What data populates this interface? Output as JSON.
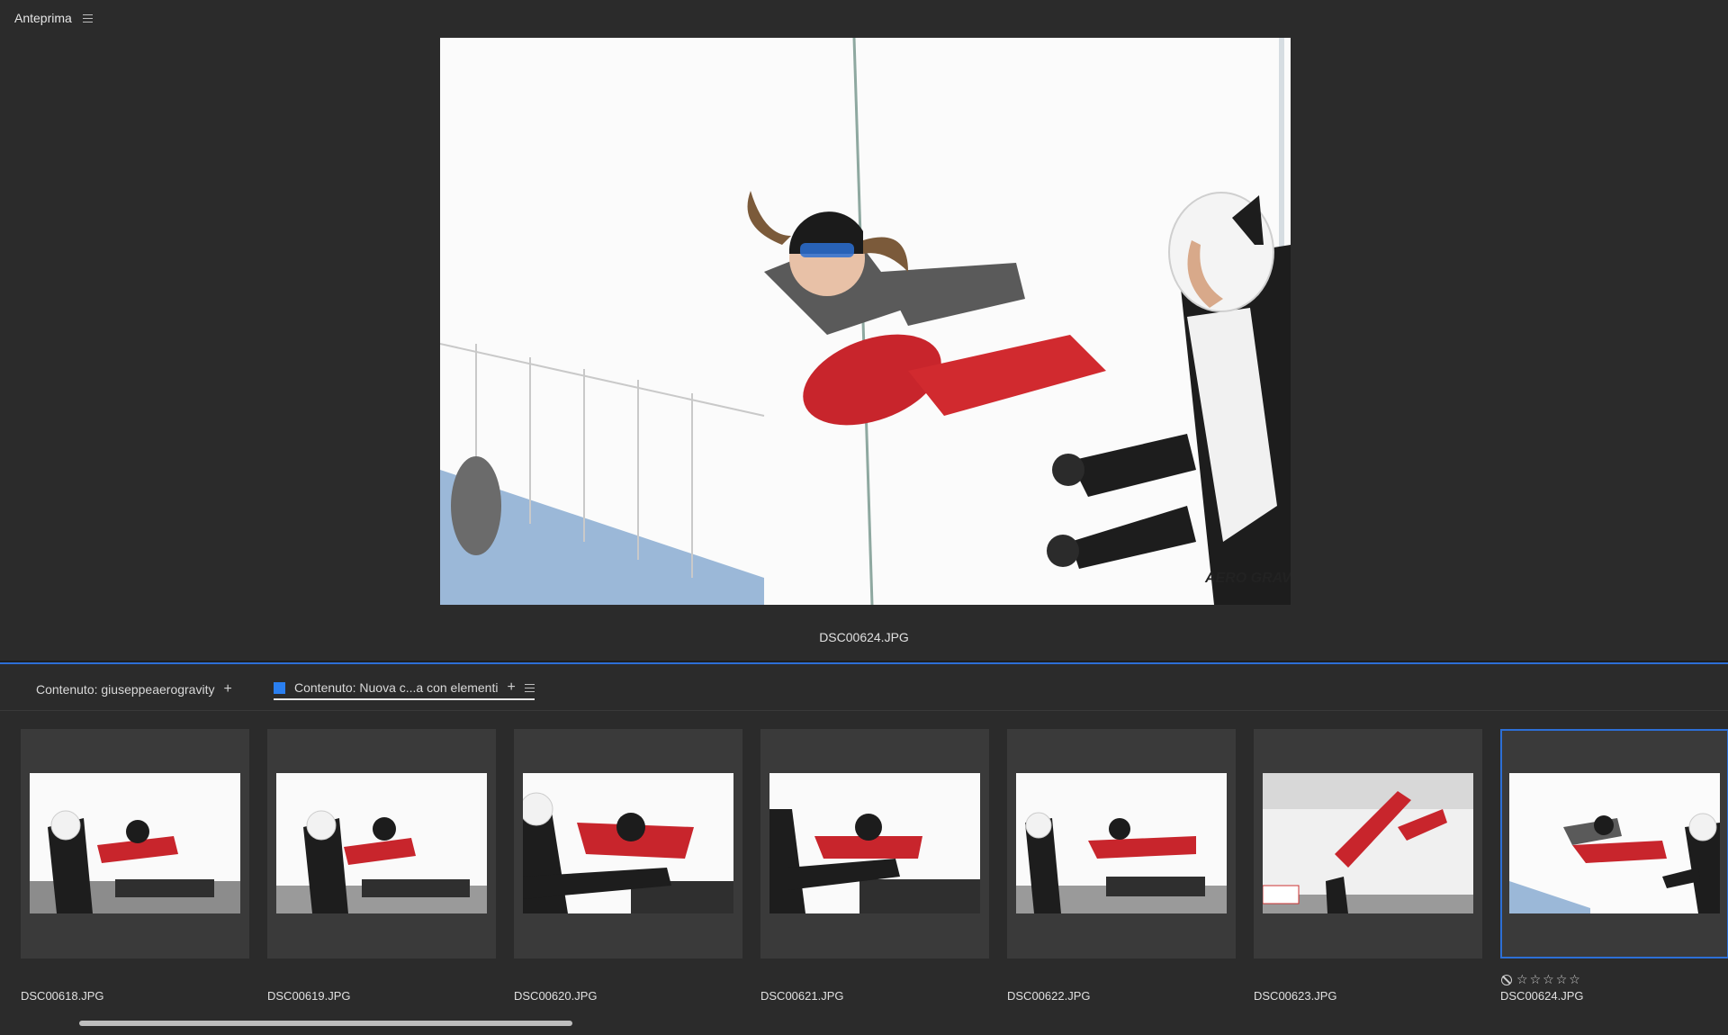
{
  "preview": {
    "title": "Anteprima",
    "caption": "DSC00624.JPG",
    "watermark": "AERO GRAVITY"
  },
  "tabs": [
    {
      "label": "Contenuto: giuseppeaerogravity",
      "active": false
    },
    {
      "label": "Contenuto: Nuova c...a con elementi",
      "active": true
    }
  ],
  "thumbnails": [
    {
      "label": "DSC00618.JPG",
      "selected": false
    },
    {
      "label": "DSC00619.JPG",
      "selected": false
    },
    {
      "label": "DSC00620.JPG",
      "selected": false
    },
    {
      "label": "DSC00621.JPG",
      "selected": false
    },
    {
      "label": "DSC00622.JPG",
      "selected": false
    },
    {
      "label": "DSC00623.JPG",
      "selected": false
    },
    {
      "label": "DSC00624.JPG",
      "selected": true
    }
  ],
  "selected_rating": {
    "stars": 0,
    "max": 5,
    "rejected": false
  },
  "colors": {
    "accent": "#2d6fd6",
    "panel": "#2b2b2b",
    "thumb_bg": "#3a3a3a"
  }
}
